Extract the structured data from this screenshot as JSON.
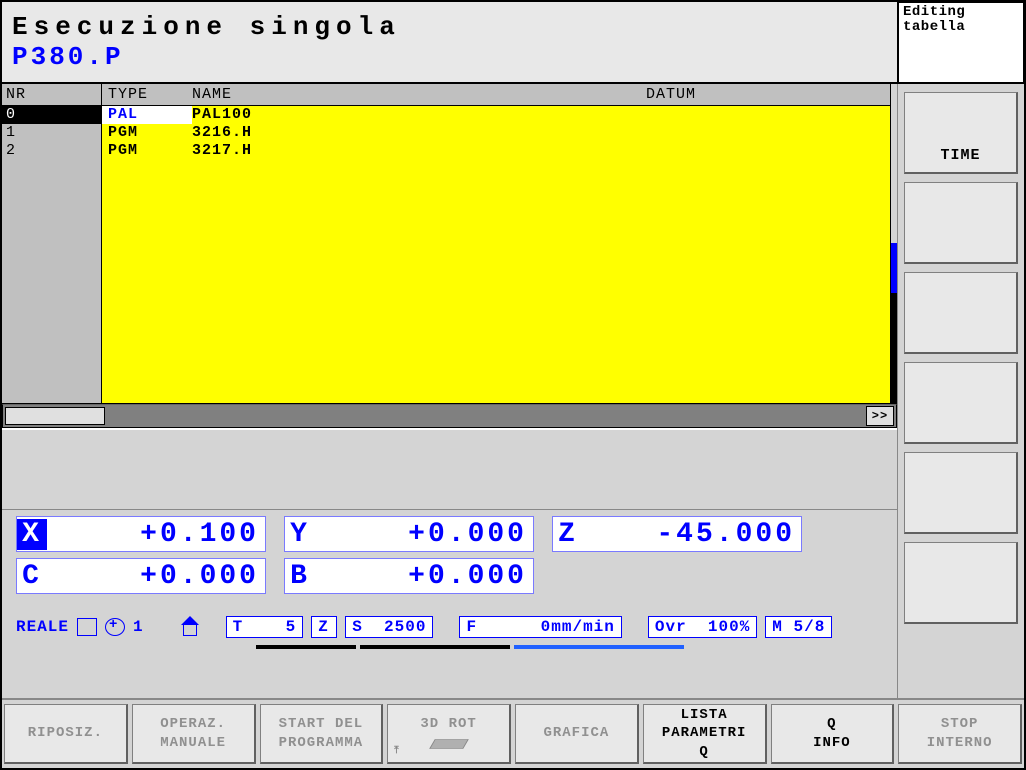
{
  "header": {
    "title": "Esecuzione singola",
    "file": "P380.P",
    "mode_line1": "Editing",
    "mode_line2": "tabella"
  },
  "table": {
    "col_nr": "NR",
    "col_type": "TYPE",
    "col_name": "NAME",
    "col_datum": "DATUM",
    "rows": [
      {
        "nr": "0",
        "type": "PAL",
        "name": "PAL100",
        "selected": true
      },
      {
        "nr": "1",
        "type": "PGM",
        "name": "3216.H",
        "selected": false
      },
      {
        "nr": "2",
        "type": "PGM",
        "name": "3217.H",
        "selected": false
      }
    ],
    "scroll_btn": ">>"
  },
  "dro": {
    "axes": [
      {
        "label": "X",
        "value": "+0.100",
        "highlight": true
      },
      {
        "label": "Y",
        "value": "+0.000",
        "highlight": false
      },
      {
        "label": "Z",
        "value": "-45.000",
        "highlight": false
      },
      {
        "label": "C",
        "value": "+0.000",
        "highlight": false
      },
      {
        "label": "B",
        "value": "+0.000",
        "highlight": false
      }
    ]
  },
  "status": {
    "mode": "REALE",
    "index": "1",
    "t": "T    5",
    "z": "Z",
    "s": "S  2500",
    "f": "F      0mm/min",
    "ovr": "Ovr  100%",
    "m": "M 5/8"
  },
  "right_keys": [
    "TIME",
    "",
    "",
    "",
    "",
    ""
  ],
  "bottom_keys": [
    {
      "l1": "RIPOSIZ.",
      "l2": "",
      "disabled": true
    },
    {
      "l1": "OPERAZ.",
      "l2": "MANUALE",
      "disabled": true
    },
    {
      "l1": "START DEL",
      "l2": "PROGRAMMA",
      "disabled": true
    },
    {
      "l1": "3D ROT",
      "l2": "",
      "disabled": true,
      "icon": true
    },
    {
      "l1": "GRAFICA",
      "l2": "",
      "disabled": true
    },
    {
      "l1": "LISTA",
      "l2": "PARAMETRI",
      "l3": "Q",
      "disabled": false
    },
    {
      "l1": "Q",
      "l2": "INFO",
      "disabled": false
    },
    {
      "l1": "STOP",
      "l2": "INTERNO",
      "disabled": true
    }
  ]
}
